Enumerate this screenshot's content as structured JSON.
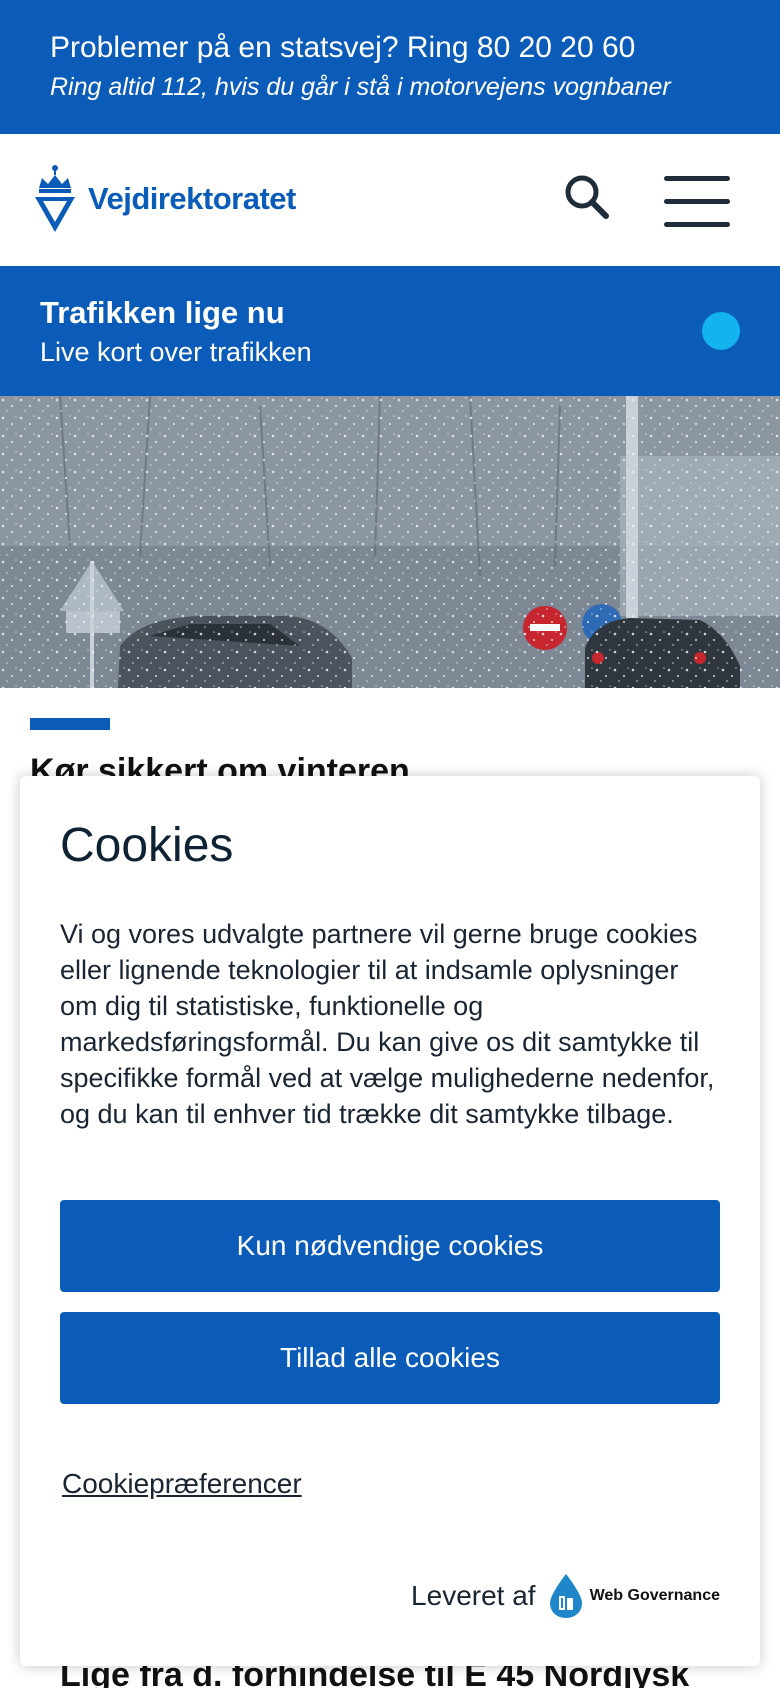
{
  "top_banner": {
    "line1": "Problemer på en statsvej? Ring 80 20 20 60",
    "line2": "Ring altid 112, hvis du går i stå i motorvejens vognbaner",
    "background": "#0a5cb8"
  },
  "header": {
    "logo_text": "Vejdirektoratet",
    "search_icon": "search-icon",
    "menu_icon": "hamburger-menu-icon"
  },
  "traffic": {
    "title": "Trafikken lige nu",
    "subtitle": "Live kort over trafikken",
    "indicator_color": "#12b3ee"
  },
  "article": {
    "title": "Kør sikkert om vinteren",
    "bottom_text": "Lige fra d. forhindelse til E 45 Nordjysk"
  },
  "cookie_dialog": {
    "title": "Cookies",
    "body": "Vi og vores udvalgte partnere vil gerne bruge cookies eller lignende teknologier til at indsamle oplysninger om dig til statistiske, funktionelle og markedsføringsformål. Du kan give os dit samtykke til specifikke formål ved at vælge mulighederne nedenfor, og du kan til enhver tid trække dit samtykke tilbage.",
    "necessary_button": "Kun nødvendige cookies",
    "allow_all_button": "Tillad alle cookies",
    "preferences_link": "Cookiepræferencer",
    "provider_label": "Leveret af",
    "provider_name": "Web Governance",
    "button_color": "#0a5cb8"
  }
}
